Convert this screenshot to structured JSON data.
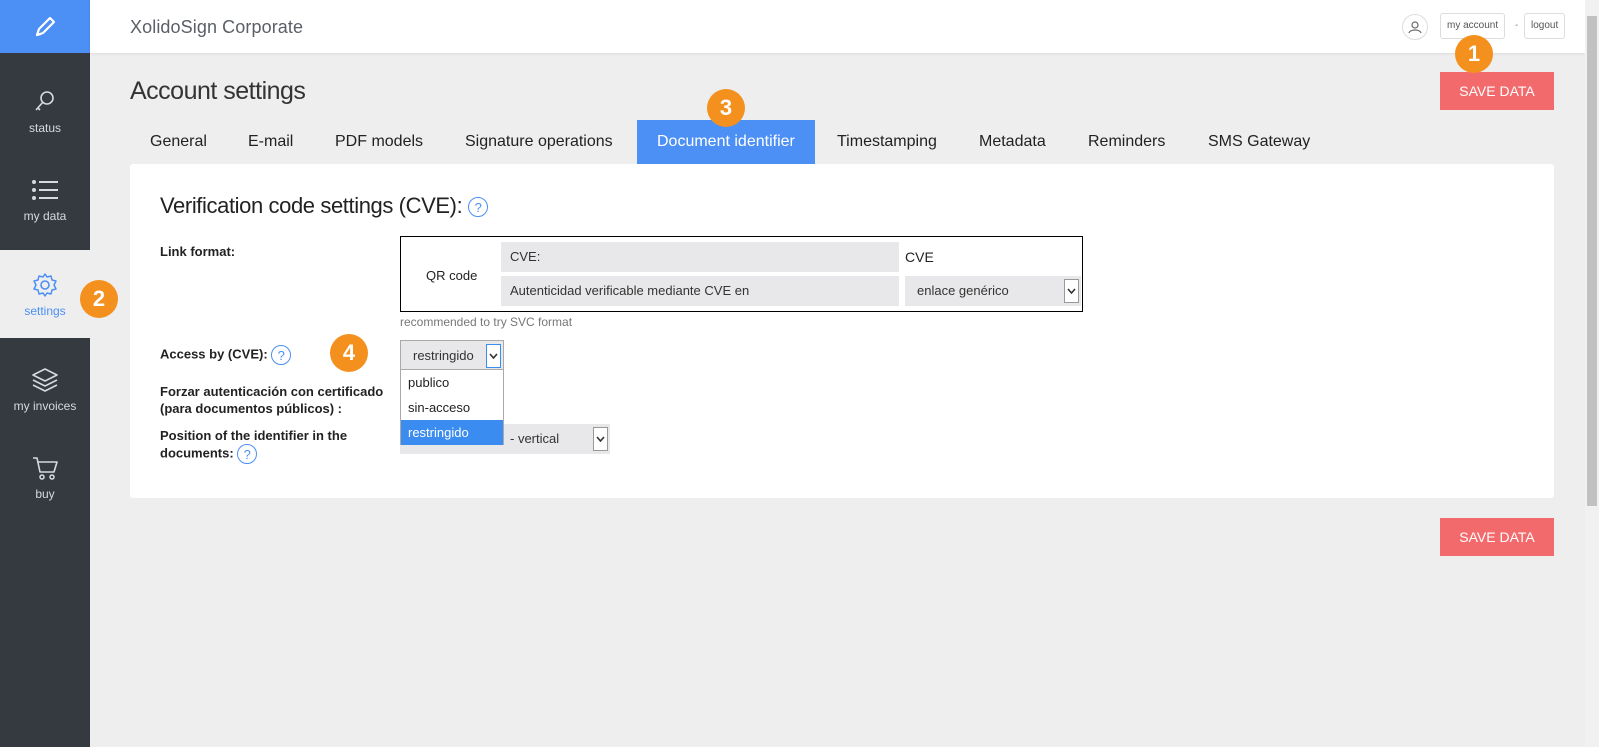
{
  "app": {
    "title": "XolidoSign Corporate"
  },
  "header": {
    "my_account": "my account",
    "separator": "-",
    "logout": "logout"
  },
  "sidebar": {
    "items": [
      {
        "label": "status",
        "icon": "key-icon"
      },
      {
        "label": "my data",
        "icon": "list-icon"
      },
      {
        "label": "settings",
        "icon": "gear-icon",
        "active": true
      },
      {
        "label": "my invoices",
        "icon": "layers-icon"
      },
      {
        "label": "buy",
        "icon": "cart-icon"
      }
    ]
  },
  "page": {
    "title": "Account settings",
    "save_label": "SAVE DATA"
  },
  "tabs": [
    {
      "label": "General"
    },
    {
      "label": "E-mail"
    },
    {
      "label": "PDF models"
    },
    {
      "label": "Signature operations"
    },
    {
      "label": "Document identifier",
      "active": true
    },
    {
      "label": "Timestamping"
    },
    {
      "label": "Metadata"
    },
    {
      "label": "Reminders"
    },
    {
      "label": "SMS Gateway"
    }
  ],
  "section": {
    "title": "Verification code settings (CVE):",
    "help": "?",
    "link_format": {
      "label": "Link format:",
      "qr_label": "QR code",
      "cve_prefix_value": "CVE:",
      "cve_text": "CVE",
      "auth_text_value": "Autenticidad verificable mediante CVE en",
      "link_type_selected": "enlace genérico",
      "hint": "recommended to try SVC format"
    },
    "access": {
      "label": "Access by (CVE):",
      "selected": "restringido",
      "options": [
        "publico",
        "sin-acceso",
        "restringido"
      ]
    },
    "force_auth": {
      "label_line1": "Forzar autenticación con certificado",
      "label_line2": "(para documentos públicos) :"
    },
    "position": {
      "label_line1": "Position of the identifier in the",
      "label_line2": "documents:",
      "selected": "- vertical"
    }
  },
  "badges": [
    "1",
    "2",
    "3",
    "4"
  ],
  "colors": {
    "accent": "#4c8ff5",
    "save": "#f36a6c",
    "sidebar": "#343a40",
    "badge": "#f4901e"
  }
}
